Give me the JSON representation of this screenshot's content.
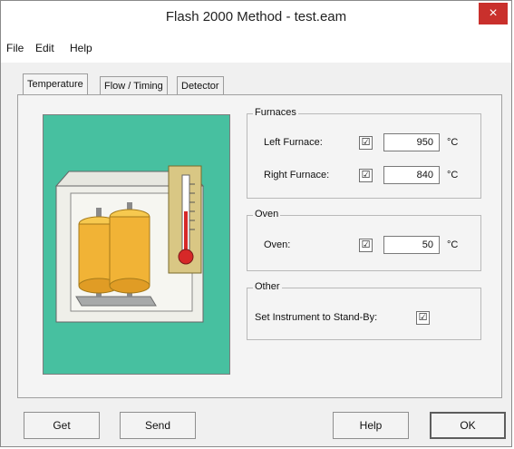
{
  "window": {
    "title": "Flash 2000 Method - test.eam",
    "close_glyph": "×"
  },
  "menu": [
    "File",
    "Edit",
    "Help"
  ],
  "tabs": [
    "Temperature",
    "Flow / Timing",
    "Detector"
  ],
  "furnaces": {
    "title": "Furnaces",
    "left": {
      "label": "Left Furnace:",
      "checked": "☑",
      "value": "950",
      "unit": "°C"
    },
    "right": {
      "label": "Right Furnace:",
      "checked": "☑",
      "value": "840",
      "unit": "°C"
    }
  },
  "oven": {
    "title": "Oven",
    "oven": {
      "label": "Oven:",
      "checked": "☑",
      "value": "50",
      "unit": "°C"
    }
  },
  "other": {
    "title": "Other",
    "standby": {
      "label": "Set Instrument to Stand-By:",
      "checked": "☑"
    }
  },
  "buttons": {
    "get": "Get",
    "send": "Send",
    "help": "Help",
    "ok": "OK"
  },
  "colors": {
    "illustration_bg": "#47c0a0",
    "accent_close": "#c9302c"
  }
}
